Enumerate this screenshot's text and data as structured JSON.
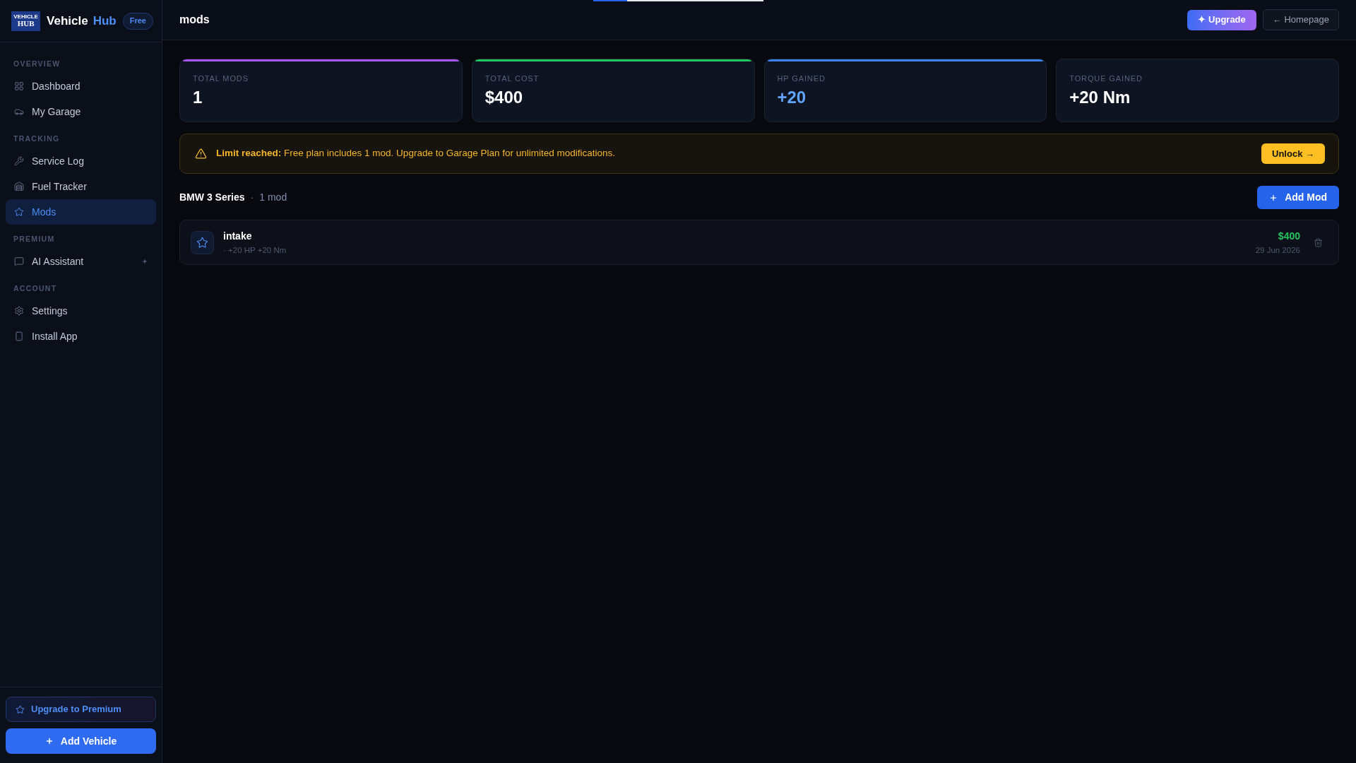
{
  "sidebar": {
    "logo": {
      "line_1": "VEHICLE",
      "line_2": "HUB"
    },
    "brand": {
      "name": "Vehicle",
      "accent": "Hub"
    },
    "plan_badge": "Free",
    "sections": [
      {
        "label": "OVERVIEW",
        "items": [
          {
            "label": "Dashboard",
            "selected": false,
            "premium": false
          },
          {
            "label": "My Garage",
            "selected": false,
            "premium": false
          }
        ]
      },
      {
        "label": "TRACKING",
        "items": [
          {
            "label": "Service Log",
            "selected": false,
            "premium": false
          },
          {
            "label": "Fuel Tracker",
            "selected": false,
            "premium": false
          },
          {
            "label": "Mods",
            "selected": true,
            "premium": false
          }
        ]
      },
      {
        "label": "PREMIUM",
        "items": [
          {
            "label": "AI Assistant",
            "selected": false,
            "premium": true
          }
        ]
      },
      {
        "label": "ACCOUNT",
        "items": [
          {
            "label": "Settings",
            "selected": false,
            "premium": false
          },
          {
            "label": "Install App",
            "selected": false,
            "premium": false
          }
        ]
      }
    ],
    "upgrade_button": "Upgrade to Premium",
    "add_button": "Add Vehicle"
  },
  "header": {
    "title": "mods",
    "upgrade_button": "✦ Upgrade",
    "home_button": "← Homepage"
  },
  "stats": [
    {
      "label": "TOTAL MODS",
      "value": "1",
      "color": "#a855f7",
      "highlighted": false
    },
    {
      "label": "TOTAL COST",
      "value": "$400",
      "color": "#22c55e",
      "highlighted": false
    },
    {
      "label": "HP GAINED",
      "value": "+20",
      "color": "#3b82f6",
      "highlighted": true
    },
    {
      "label": "TORQUE GAINED",
      "value": "+20 Nm",
      "highlighted": false
    }
  ],
  "alert": {
    "message": "**Limit reached:** Free plan includes 1 mod. Upgrade to Garage Plan for unlimited modifications.",
    "button": "Unlock →"
  },
  "vehicle": {
    "name": "BMW 3 Series",
    "separator": "·",
    "count": "1 mod",
    "add_button": "Add Mod"
  },
  "mods": [
    {
      "name": "intake",
      "details": "· +20 HP +20 Nm",
      "cost": "$400",
      "date": "29 Jun 2026"
    }
  ]
}
